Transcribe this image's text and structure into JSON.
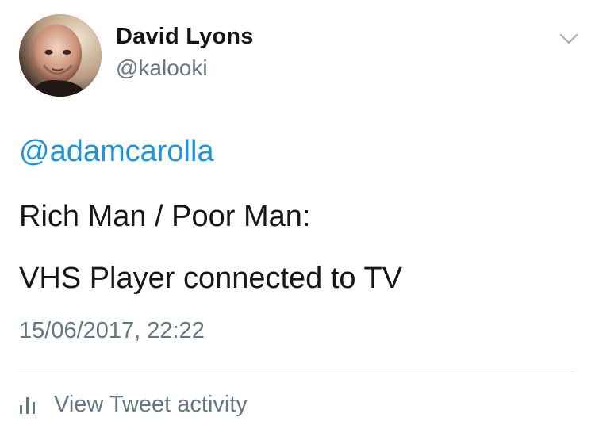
{
  "tweet": {
    "author": {
      "name": "David Lyons",
      "handle": "@kalooki",
      "avatar_icon": "user-avatar-photo"
    },
    "menu_icon": "chevron-down-icon",
    "mention": "@adamcarolla",
    "lines": [
      "Rich Man / Poor Man:",
      "VHS Player connected to TV"
    ],
    "timestamp": "15/06/2017, 22:22",
    "activity": {
      "icon": "bar-chart-icon",
      "label": "View Tweet activity"
    }
  },
  "colors": {
    "text": "#14171a",
    "secondary": "#657786",
    "link": "#1b95e0",
    "divider": "#d8dee3"
  }
}
